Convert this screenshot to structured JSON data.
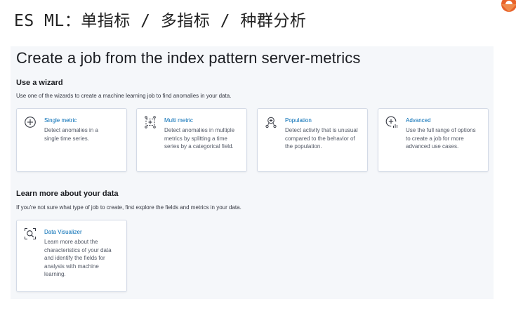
{
  "slide_title": "ES ML：单指标 / 多指标 / 种群分析",
  "page_title": "Create a job from the index pattern server-metrics",
  "wizard_section": {
    "title": "Use a wizard",
    "description": "Use one of the wizards to create a machine learning job to find anomalies in your data.",
    "cards": [
      {
        "title": "Single metric",
        "description": "Detect anomalies in a single time series.",
        "icon": "plus-circle-icon"
      },
      {
        "title": "Multi metric",
        "description": "Detect anomalies in multiple metrics by splitting a time series by a categorical field.",
        "icon": "multi-metric-icon"
      },
      {
        "title": "Population",
        "description": "Detect activity that is unusual compared to the behavior of the population.",
        "icon": "population-icon"
      },
      {
        "title": "Advanced",
        "description": "Use the full range of options to create a job for more advanced use cases.",
        "icon": "advanced-icon"
      }
    ]
  },
  "learn_section": {
    "title": "Learn more about your data",
    "description": "If you're not sure what type of job to create, first explore the fields and metrics in your data.",
    "cards": [
      {
        "title": "Data Visualizer",
        "description": "Learn more about the characteristics of your data and identify the fields for analysis with machine learning.",
        "icon": "data-visualizer-icon"
      }
    ]
  },
  "colors": {
    "link": "#006bb4",
    "panel_background": "#f5f7fa",
    "card_border": "#d3dae6",
    "logo_orange": "#e8622a"
  }
}
